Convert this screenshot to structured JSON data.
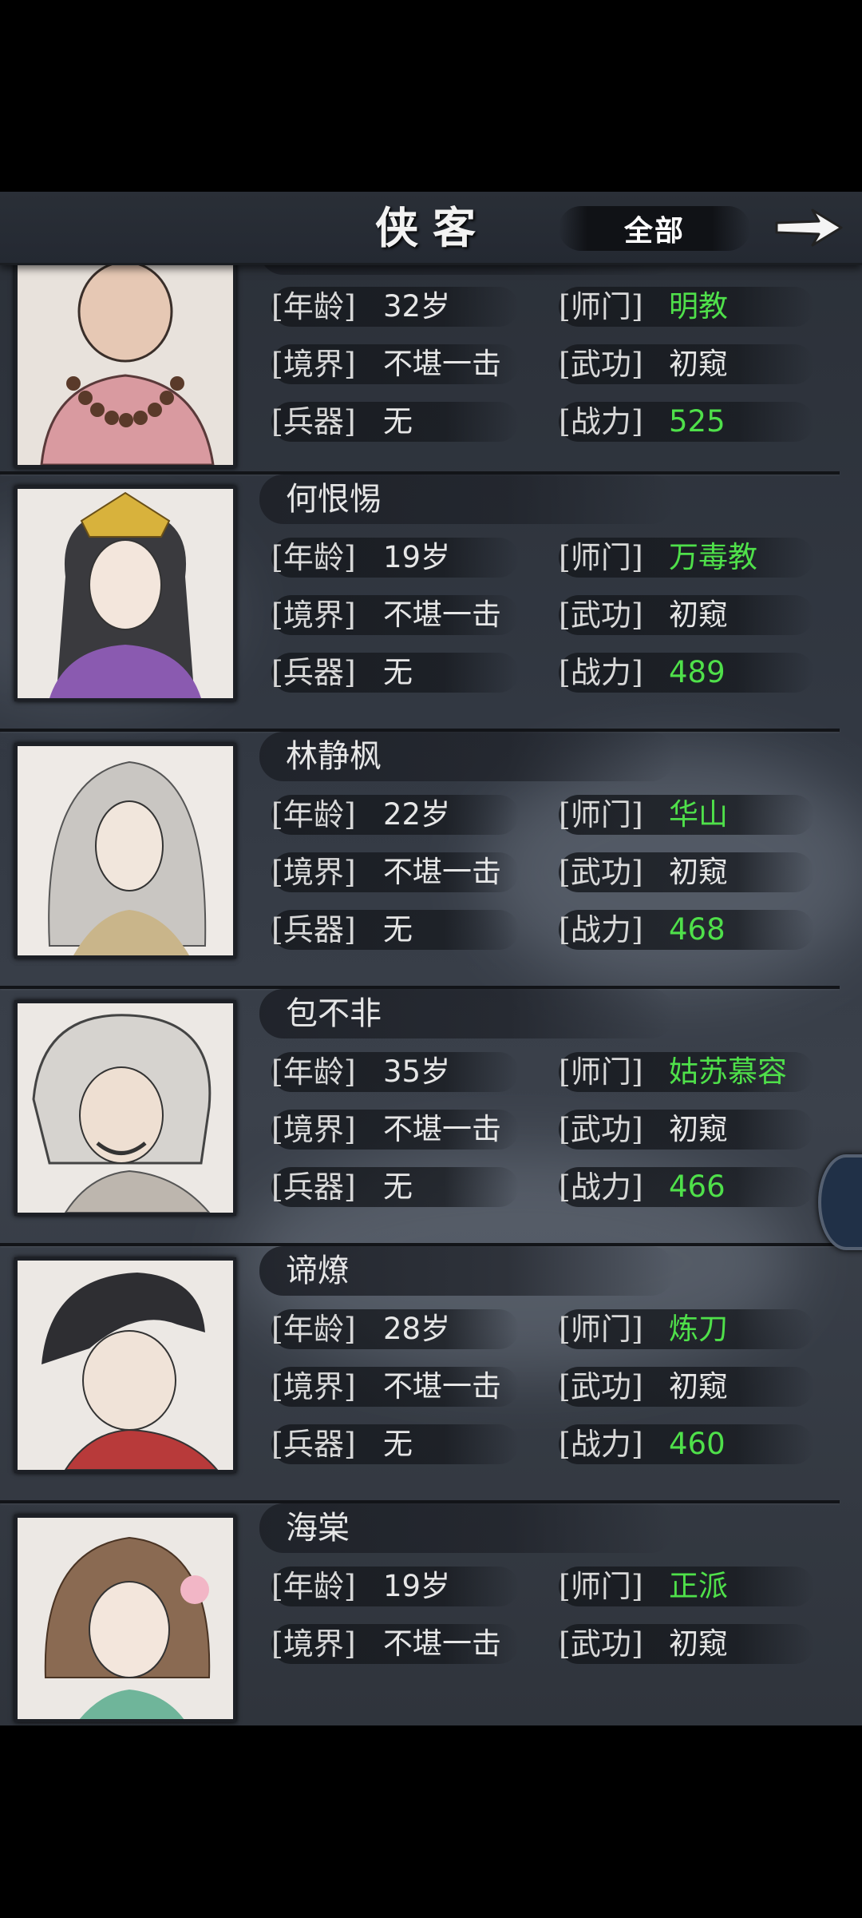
{
  "header": {
    "title": "侠客",
    "filter_label": "全部",
    "arrow_icon": "right-arrow-icon"
  },
  "labels": {
    "age": "[年龄]",
    "realm": "[境界]",
    "weapon": "[兵器]",
    "sect": "[师门]",
    "martial": "[武功]",
    "power": "[战力]"
  },
  "colors": {
    "accent_green": "#4fe04a",
    "background": "#323842"
  },
  "characters": [
    {
      "name": "",
      "age": "32岁",
      "realm": "不堪一击",
      "weapon": "无",
      "sect": "明教",
      "martial": "初窥",
      "power": "525"
    },
    {
      "name": "何恨惕",
      "age": "19岁",
      "realm": "不堪一击",
      "weapon": "无",
      "sect": "万毒教",
      "martial": "初窥",
      "power": "489"
    },
    {
      "name": "林静枫",
      "age": "22岁",
      "realm": "不堪一击",
      "weapon": "无",
      "sect": "华山",
      "martial": "初窥",
      "power": "468"
    },
    {
      "name": "包不非",
      "age": "35岁",
      "realm": "不堪一击",
      "weapon": "无",
      "sect": "姑苏慕容",
      "martial": "初窥",
      "power": "466"
    },
    {
      "name": "谛燎",
      "age": "28岁",
      "realm": "不堪一击",
      "weapon": "无",
      "sect": "炼刀",
      "martial": "初窥",
      "power": "460"
    },
    {
      "name": "海棠",
      "age": "19岁",
      "realm": "不堪一击",
      "weapon": "",
      "sect": "正派",
      "martial": "初窥",
      "power": ""
    }
  ]
}
